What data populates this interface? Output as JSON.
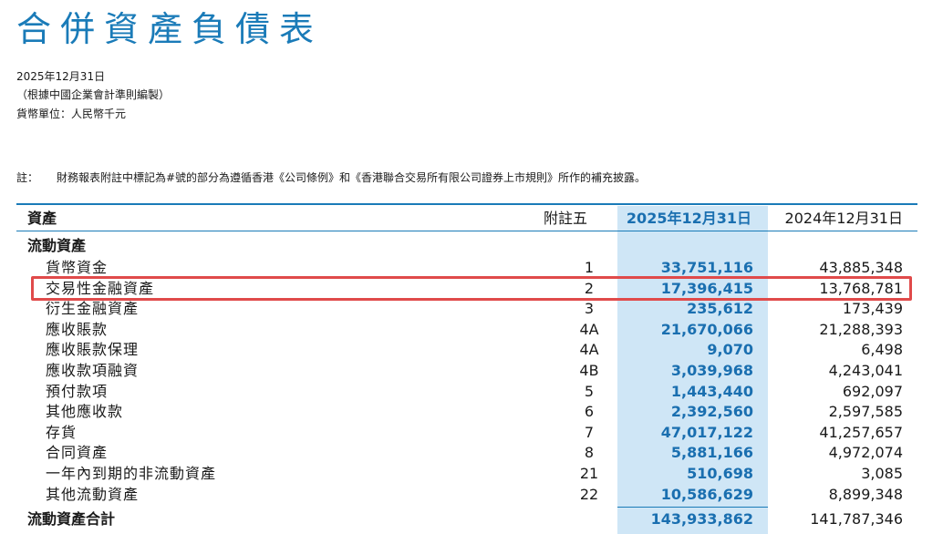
{
  "title": "合併資產負債表",
  "meta": {
    "date": "2025年12月31日",
    "basis": "（根據中國企業會計準則編製）",
    "currency": "貨幣單位：人民幣千元"
  },
  "note": {
    "label": "註：",
    "text": "財務報表附註中標記為#號的部分為遵循香港《公司條例》和《香港聯合交易所有限公司證券上市規則》所作的補充披露。"
  },
  "table": {
    "header": {
      "asset": "資產",
      "note": "附註五",
      "col_2025": "2025年12月31日",
      "col_2024": "2024年12月31日"
    },
    "section": "流動資產",
    "rows": [
      {
        "label": "貨幣資金",
        "note": "1",
        "v2025": "33,751,116",
        "v2024": "43,885,348"
      },
      {
        "label": "交易性金融資產",
        "note": "2",
        "v2025": "17,396,415",
        "v2024": "13,768,781"
      },
      {
        "label": "衍生金融資產",
        "note": "3",
        "v2025": "235,612",
        "v2024": "173,439"
      },
      {
        "label": "應收賬款",
        "note": "4A",
        "v2025": "21,670,066",
        "v2024": "21,288,393"
      },
      {
        "label": "應收賬款保理",
        "note": "4A",
        "v2025": "9,070",
        "v2024": "6,498"
      },
      {
        "label": "應收款項融資",
        "note": "4B",
        "v2025": "3,039,968",
        "v2024": "4,243,041"
      },
      {
        "label": "預付款項",
        "note": "5",
        "v2025": "1,443,440",
        "v2024": "692,097"
      },
      {
        "label": "其他應收款",
        "note": "6",
        "v2025": "2,392,560",
        "v2024": "2,597,585"
      },
      {
        "label": "存貨",
        "note": "7",
        "v2025": "47,017,122",
        "v2024": "41,257,657"
      },
      {
        "label": "合同資產",
        "note": "8",
        "v2025": "5,881,166",
        "v2024": "4,972,074"
      },
      {
        "label": "一年內到期的非流動資產",
        "note": "21",
        "v2025": "510,698",
        "v2024": "3,085"
      },
      {
        "label": "其他流動資產",
        "note": "22",
        "v2025": "10,586,629",
        "v2024": "8,899,348"
      }
    ],
    "total": {
      "label": "流動資產合計",
      "v2025": "143,933,862",
      "v2024": "141,787,346"
    }
  },
  "colors": {
    "accent": "#1a7bb8",
    "highlight_border": "#e04a4a",
    "column_band": "#cfe6f6"
  }
}
